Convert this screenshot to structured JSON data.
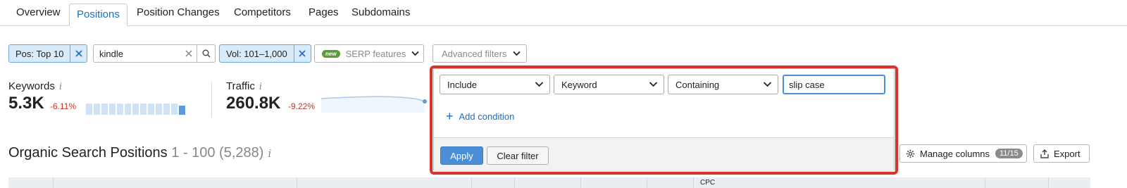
{
  "tabs": [
    {
      "label": "Overview"
    },
    {
      "label": "Positions",
      "active": true
    },
    {
      "label": "Position Changes"
    },
    {
      "label": "Competitors"
    },
    {
      "label": "Pages"
    },
    {
      "label": "Subdomains"
    }
  ],
  "filters": {
    "pos_chip": "Pos: Top 10",
    "search_value": "kindle",
    "vol_chip": "Vol: 101–1,000",
    "serp_badge": "new",
    "serp_label": "SERP features",
    "advanced_label": "Advanced filters"
  },
  "stats": {
    "keywords": {
      "label": "Keywords",
      "info": "i",
      "value": "5.3K",
      "delta": "-6.11%"
    },
    "traffic": {
      "label": "Traffic",
      "info": "i",
      "value": "260.8K",
      "delta": "-9.22%"
    }
  },
  "section": {
    "title": "Organic Search Positions",
    "count": "1 - 100 (5,288)",
    "info": "i"
  },
  "toolbar": {
    "manage_columns": "Manage columns",
    "columns_count": "11/15",
    "export": "Export"
  },
  "table": {
    "partial_header": "CPC"
  },
  "advanced_popup": {
    "include_select": "Include",
    "field_select": "Keyword",
    "operator_select": "Containing",
    "value_input": "slip case",
    "add_condition": "Add condition",
    "apply": "Apply",
    "clear": "Clear filter"
  },
  "colors": {
    "accent": "#1a6fbf",
    "chip_bg": "#d8ebfa",
    "delta_negative": "#c0392b",
    "highlight_outline": "#d9342b",
    "apply_button": "#4a8ed8"
  }
}
